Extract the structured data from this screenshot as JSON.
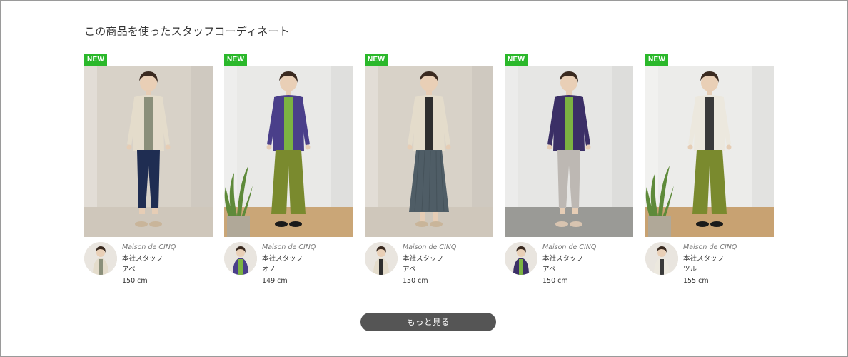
{
  "section": {
    "title": "この商品を使ったスタッフコーディネート"
  },
  "cards": [
    {
      "badge": "NEW",
      "brand": "Maison de CINQ",
      "role": "本社スタッフ",
      "staff_name": "アベ",
      "height": "150 cm",
      "outfit": {
        "top": "#e4dccb",
        "inner": "#8a8f7a",
        "bottom": "#1f2d52",
        "bottom_style": "pants",
        "shoes": "#c9b59a"
      },
      "scene": {
        "wall": "#d8d2c8",
        "floor": "#cfc7bb",
        "plant": false
      }
    },
    {
      "badge": "NEW",
      "brand": "Maison de CINQ",
      "role": "本社スタッフ",
      "staff_name": "オノ",
      "height": "149 cm",
      "outfit": {
        "top": "#4a3f8a",
        "inner": "#7cb342",
        "bottom": "#7a8a2e",
        "bottom_style": "wide",
        "shoes": "#1a1a1a"
      },
      "scene": {
        "wall": "#e9e9e7",
        "floor": "#caa677",
        "plant": true
      }
    },
    {
      "badge": "NEW",
      "brand": "Maison de CINQ",
      "role": "本社スタッフ",
      "staff_name": "アベ",
      "height": "150 cm",
      "outfit": {
        "top": "#e4dccb",
        "inner": "#2e2e2e",
        "bottom": "#4f5d66",
        "bottom_style": "skirt",
        "shoes": "#c9b59a"
      },
      "scene": {
        "wall": "#d8d2c8",
        "floor": "#cfc7bb",
        "plant": false
      }
    },
    {
      "badge": "NEW",
      "brand": "Maison de CINQ",
      "role": "本社スタッフ",
      "staff_name": "アベ",
      "height": "150 cm",
      "outfit": {
        "top": "#3b2f66",
        "inner": "#7cb342",
        "bottom": "#bdb8b3",
        "bottom_style": "pants",
        "shoes": "#d8c4b0"
      },
      "scene": {
        "wall": "#e6e6e4",
        "floor": "#9a9a96",
        "plant": false
      }
    },
    {
      "badge": "NEW",
      "brand": "Maison de CINQ",
      "role": "本社スタッフ",
      "staff_name": "ツル",
      "height": "155 cm",
      "outfit": {
        "top": "#ece8de",
        "inner": "#3a3a3a",
        "bottom": "#7a8a2e",
        "bottom_style": "wide",
        "shoes": "#1a1a1a"
      },
      "scene": {
        "wall": "#ececea",
        "floor": "#c8a272",
        "plant": true
      }
    }
  ],
  "more_button": {
    "label": "もっと見る"
  },
  "colors": {
    "badge_green": "#2bb82b",
    "button_gray": "#555555"
  }
}
